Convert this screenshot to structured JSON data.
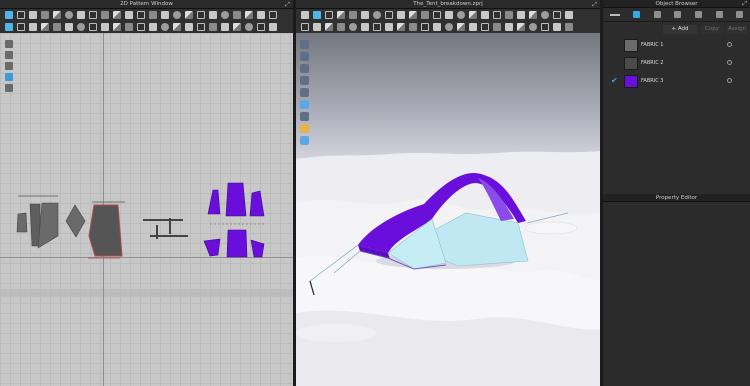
{
  "windows": {
    "pattern_2d": {
      "title": "2D Pattern Window"
    },
    "view_3d": {
      "title": "The_Tent_breakdown.zprj"
    },
    "object_browser": {
      "title": "Object Browser"
    },
    "property_editor": {
      "title": "Property Editor"
    }
  },
  "object_browser": {
    "add_label": "Add",
    "button_2": "Copy",
    "button_3": "Assign",
    "fabrics": [
      {
        "name": "FABRIC 1",
        "color": "#6b6b6b",
        "selected": false
      },
      {
        "name": "FABRIC 2",
        "color": "#4a4a4a",
        "selected": false
      },
      {
        "name": "FABRIC 3",
        "color": "#6a0fdb",
        "selected": true
      }
    ]
  },
  "colors": {
    "accent": "#39a7e3",
    "fabric_purple": "#6a0fdb",
    "pattern_gray": "#626262",
    "mesh_light_blue": "#bfe8f3",
    "panel_bg": "#2c2c2c"
  },
  "icons": {
    "toolbar_2d": [
      "select-pattern-icon",
      "transform-icon",
      "edit-point-icon",
      "polygon-icon",
      "rectangle-icon",
      "circle-icon",
      "sewing-icon",
      "segment-sewing-icon",
      "free-sewing-icon",
      "internal-line-icon",
      "notch-icon",
      "fold-icon",
      "tack-icon",
      "texture-icon",
      "graphic-icon"
    ],
    "toolbar_3d": [
      "select-move-icon",
      "transform-icon",
      "fold-arrangement-icon",
      "simulation-icon",
      "pin-icon",
      "avatar-icon",
      "tape-icon",
      "fit-icon",
      "camera-icon",
      "light-icon"
    ],
    "side_2d": [
      "move-view-icon",
      "zoom-icon",
      "pen-icon",
      "layer-icon",
      "sewing-display-icon"
    ],
    "side_3d": [
      "view-avatar-icon",
      "view-garment-icon",
      "view-stress-icon",
      "view-texture-icon",
      "view-sewing-icon",
      "view-mesh-icon",
      "view-light-icon",
      "view-camera-icon",
      "view-reset-icon"
    ]
  }
}
